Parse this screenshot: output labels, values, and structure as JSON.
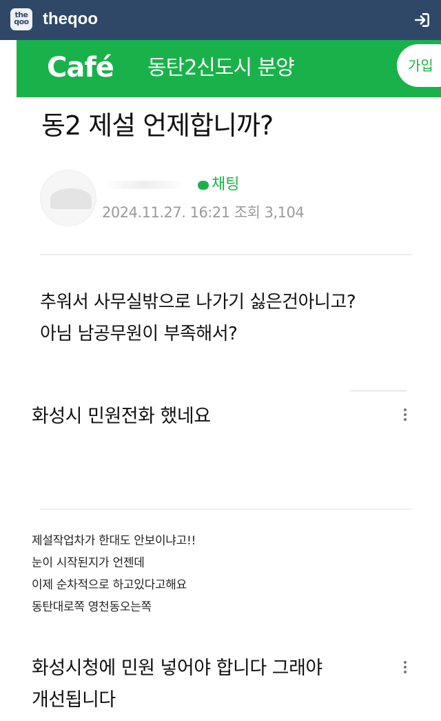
{
  "site": {
    "logo_text": "theqoo",
    "name": "theqoo",
    "login_icon": "login-icon"
  },
  "cafe": {
    "logo": "Café",
    "name": "동탄2신도시 분양",
    "join_label": "가입"
  },
  "post": {
    "title": "동2 제설 언제합니까?",
    "chat_label": "채팅",
    "meta": "2024.11.27. 16:21  조회 3,104",
    "body": [
      "추워서 사무실밖으로 나가기 싫은건아니고?",
      "아님 남공무원이 부족해서?"
    ]
  },
  "comments": [
    {
      "title": "화성시 민원전화 했네요",
      "body": [
        "제설작업차가 한대도 안보이냐고!!",
        "눈이 시작된지가 언젠데",
        "이제 순차적으로 하고있다고해요",
        "동탄대로쪽 영천동오는쪽"
      ]
    },
    {
      "title": "화성시청에 민원 넣어야 합니다 그래야 개선됩니다",
      "title_lines": [
        "화성시청에 민원 넣어야 합니다 그래야",
        "개선됩니다"
      ]
    }
  ],
  "colors": {
    "topbar": "#2f4868",
    "cafe_green": "#19b24a",
    "meta_gray": "#9a9a9a"
  }
}
